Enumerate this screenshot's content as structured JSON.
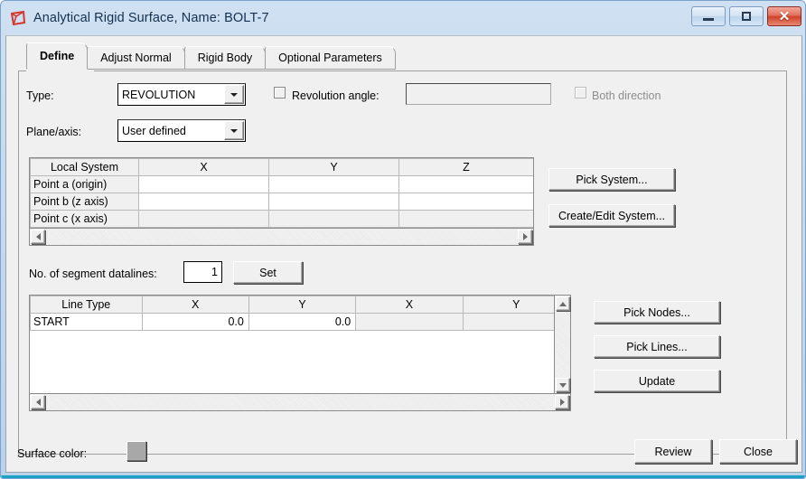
{
  "window": {
    "title": "Analytical Rigid Surface,  Name: BOLT-7",
    "icon": "rigid-surface-icon",
    "controls": {
      "minimize": "minimize-icon",
      "maximize": "maximize-icon",
      "close": "close-icon"
    },
    "close_color": "#cf4128",
    "titlebar_color": "#c3d8ee",
    "accent_bottom": "#1aa3c4"
  },
  "tabs": [
    {
      "label": "Define",
      "active": true
    },
    {
      "label": "Adjust Normal",
      "active": false
    },
    {
      "label": "Rigid Body",
      "active": false
    },
    {
      "label": "Optional Parameters",
      "active": false
    }
  ],
  "define": {
    "type_label": "Type:",
    "type_value": "REVOLUTION",
    "plane_label": "Plane/axis:",
    "plane_value": "User defined",
    "revolution_angle_label": "Revolution angle:",
    "revolution_angle_checked": false,
    "revolution_angle_value": "",
    "both_direction_label": "Both direction",
    "both_direction_checked": false,
    "both_direction_disabled": true
  },
  "local_system_table": {
    "headers": [
      "Local System",
      "X",
      "Y",
      "Z"
    ],
    "rows": [
      {
        "label": "Point a (origin)",
        "cells": [
          "",
          "",
          ""
        ]
      },
      {
        "label": "Point b (z axis)",
        "cells": [
          "",
          "",
          ""
        ]
      },
      {
        "label": "Point c (x axis)",
        "cells": [
          "",
          "",
          ""
        ]
      }
    ]
  },
  "system_buttons": {
    "pick_system": "Pick System...",
    "create_edit_system": "Create/Edit System..."
  },
  "segment": {
    "label": "No. of segment datalines:",
    "value": "1",
    "set_button": "Set"
  },
  "line_table": {
    "headers": [
      "Line Type",
      "X",
      "Y",
      "X",
      "Y"
    ],
    "rows": [
      {
        "type": "START",
        "cells": [
          "0.0",
          "0.0",
          "",
          ""
        ]
      }
    ]
  },
  "line_buttons": {
    "pick_nodes": "Pick Nodes...",
    "pick_lines": "Pick Lines...",
    "update": "Update"
  },
  "footer": {
    "surface_color_label": "Surface color:",
    "surface_color_value": "#a8a8a8",
    "review_button": "Review",
    "close_button": "Close"
  }
}
